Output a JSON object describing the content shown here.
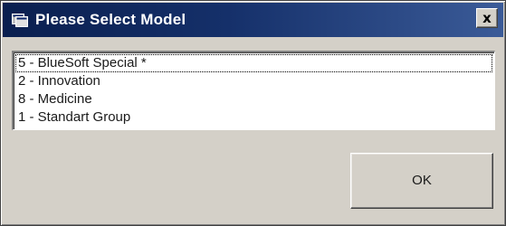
{
  "window": {
    "title": "Please Select Model",
    "close_label": "x",
    "title_icon": "app-window-icon"
  },
  "model_list": {
    "selected_index": 0,
    "items": [
      {
        "label": "5 - BlueSoft Special *"
      },
      {
        "label": "2 - Innovation"
      },
      {
        "label": "8 - Medicine"
      },
      {
        "label": "1 - Standart Group"
      }
    ]
  },
  "buttons": {
    "ok_label": "OK"
  },
  "colors": {
    "titlebar_start": "#0a1f4f",
    "titlebar_end": "#3b5b98",
    "face": "#d4d0c8"
  }
}
